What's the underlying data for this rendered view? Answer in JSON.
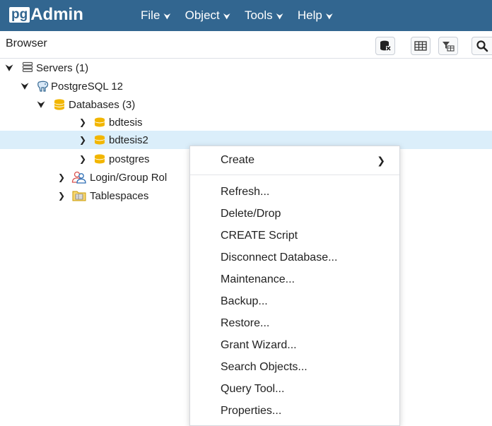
{
  "app": {
    "logo_prefix": "pg",
    "logo_suffix": "Admin"
  },
  "menu": [
    {
      "label": "File"
    },
    {
      "label": "Object"
    },
    {
      "label": "Tools"
    },
    {
      "label": "Help"
    }
  ],
  "browser": {
    "title": "Browser",
    "toolbar_icons": [
      "query-tool-icon",
      "view-data-icon",
      "filtered-rows-icon",
      "search-icon"
    ]
  },
  "tree": {
    "servers": "Servers (1)",
    "server": "PostgreSQL 12",
    "databases": "Databases (3)",
    "db1": "bdtesis",
    "db2": "bdtesis2",
    "db3": "postgres",
    "login_roles": "Login/Group Rol",
    "tablespaces": "Tablespaces"
  },
  "context_menu": {
    "create": "Create",
    "items": [
      "Refresh...",
      "Delete/Drop",
      "CREATE Script",
      "Disconnect Database...",
      "Maintenance...",
      "Backup...",
      "Restore...",
      "Grant Wizard...",
      "Search Objects...",
      "Query Tool...",
      "Properties..."
    ]
  },
  "colors": {
    "navbar": "#326690",
    "selected_row": "#dbeefa",
    "database_icon": "#f2b600"
  }
}
